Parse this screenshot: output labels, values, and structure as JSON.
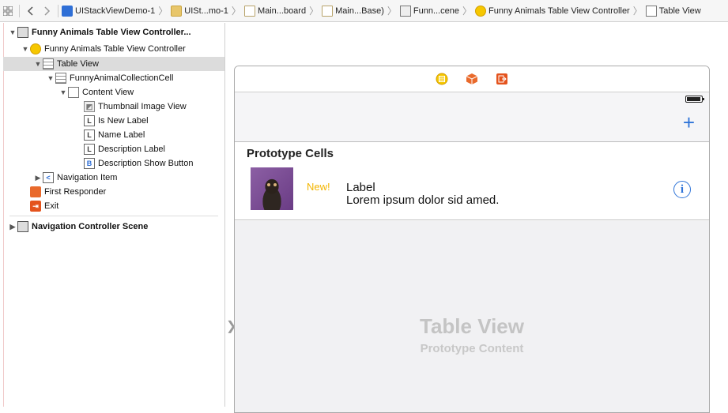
{
  "jumpbar": {
    "grid_icon": "related-items-grid-icon",
    "back_icon": "chevron-left-icon",
    "forward_icon": "chevron-right-icon",
    "crumbs": [
      {
        "label": "UIStackViewDemo-1",
        "icon": "project-icon"
      },
      {
        "label": "UISt...mo-1",
        "icon": "folder-icon"
      },
      {
        "label": "Main...board",
        "icon": "storyboard-icon"
      },
      {
        "label": "Main...Base)",
        "icon": "storyboard-icon"
      },
      {
        "label": "Funn...cene",
        "icon": "scene-icon"
      },
      {
        "label": "Funny Animals Table View Controller",
        "icon": "view-controller-icon"
      },
      {
        "label": "Table View",
        "icon": "table-view-icon"
      }
    ]
  },
  "outline": {
    "items": [
      {
        "label": "Funny Animals Table View Controller...",
        "icon": "scene-icon",
        "disclosure": "open"
      },
      {
        "label": "Funny Animals Table View Controller",
        "icon": "view-controller-icon",
        "disclosure": "open"
      },
      {
        "label": "Table View",
        "icon": "table-view-icon",
        "disclosure": "open",
        "selected": true
      },
      {
        "label": "FunnyAnimalCollectionCell",
        "icon": "table-cell-icon",
        "disclosure": "open"
      },
      {
        "label": "Content View",
        "icon": "view-icon",
        "disclosure": "open"
      },
      {
        "label": "Thumbnail Image View",
        "icon": "image-view-icon"
      },
      {
        "label": "Is New Label",
        "icon": "label-icon",
        "glyph": "L"
      },
      {
        "label": "Name Label",
        "icon": "label-icon",
        "glyph": "L"
      },
      {
        "label": "Description Label",
        "icon": "label-icon",
        "glyph": "L"
      },
      {
        "label": "Description Show Button",
        "icon": "button-icon",
        "glyph": "B"
      },
      {
        "label": "Navigation Item",
        "icon": "navigation-item-icon",
        "glyph": "<",
        "disclosure": "closed"
      },
      {
        "label": "First Responder",
        "icon": "first-responder-icon"
      },
      {
        "label": "Exit",
        "icon": "exit-icon"
      },
      {
        "label": "Navigation Controller Scene",
        "icon": "scene-icon",
        "disclosure": "closed"
      }
    ]
  },
  "canvas": {
    "dock_icons": [
      "view-controller-icon",
      "first-responder-icon",
      "exit-icon"
    ],
    "add_button": "+",
    "prototype_header": "Prototype Cells",
    "cell": {
      "new_label": "New!",
      "name_label": "Label",
      "description_label": "Lorem ipsum dolor sid amed.",
      "info_glyph": "i"
    },
    "table_title": "Table View",
    "table_subtitle": "Prototype Content"
  },
  "colors": {
    "accent": "#2f74d8",
    "new_badge": "#f3b500",
    "selection": "#dcdcdc"
  }
}
